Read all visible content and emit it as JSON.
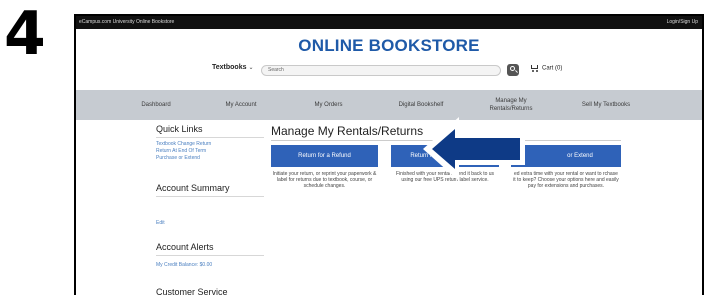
{
  "step_number": "4",
  "topbar": {
    "site_name": "eCampus.com University Online Bookstore",
    "login_label": "Login/Sign Up"
  },
  "header": {
    "title": "ONLINE BOOKSTORE",
    "textbooks_label": "Textbooks",
    "search_placeholder": "Search",
    "cart_label": "Cart (0)"
  },
  "nav": {
    "items": [
      {
        "label": "Dashboard"
      },
      {
        "label": "My Account"
      },
      {
        "label": "My Orders"
      },
      {
        "label": "Digital Bookshelf"
      },
      {
        "label": "Manage My Rentals/Returns"
      },
      {
        "label": "Sell My Textbooks"
      }
    ]
  },
  "sidebar": {
    "quick_links_title": "Quick Links",
    "quick_links": [
      "Textbook Change Return",
      "Return At End Of Term",
      "Purchase or Extend"
    ],
    "account_summary_title": "Account Summary",
    "edit_label": "Edit",
    "account_alerts_title": "Account Alerts",
    "credit_balance": "My Credit Balance: $0.00",
    "customer_service_title": "Customer Service"
  },
  "main": {
    "title": "Manage My Rentals/Returns",
    "buttons": [
      {
        "label": "Return for a Refund",
        "description": "Initiate your return, or reprint your paperwork & label for returns due to textbook, course, or schedule changes."
      },
      {
        "label": "Return my Rental for Free",
        "description": "Finished with your rental? Send it back to us using our free UPS return label service."
      },
      {
        "label": "or Extend",
        "description": "ed extra time with your rental or want to rchase it to keep? Choose your options here and easily pay for extensions and purchases."
      }
    ]
  },
  "colors": {
    "brand_blue": "#1f5aa8",
    "button_blue": "#2f62b8",
    "nav_gray": "#c6cbd1",
    "arrow_fill": "#0e3a86"
  },
  "icons": {
    "search": "search-icon",
    "cart": "cart-icon",
    "arrow": "callout-arrow-icon"
  }
}
